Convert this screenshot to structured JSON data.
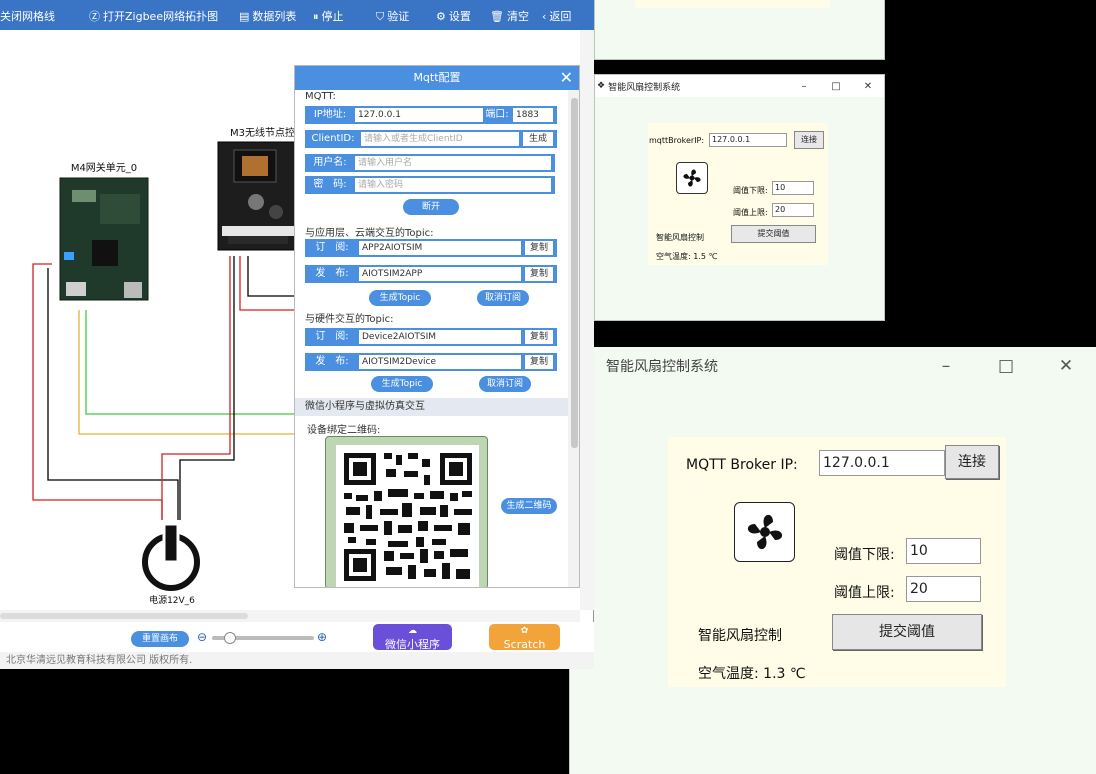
{
  "toolbar": {
    "close_grid": "关闭网格线",
    "open_zigbee": "打开Zigbee网络拓扑图",
    "data_list": "数据列表",
    "stop": "停止",
    "verify": "验证",
    "settings": "设置",
    "clear": "清空",
    "back": "返回"
  },
  "canvas": {
    "m4_label": "M4网关单元_0",
    "m3_label": "M3无线节点控",
    "power_label": "电源12V_6"
  },
  "bottombar": {
    "reset_canvas": "重置画布",
    "wechat_label": "微信小程序",
    "scratch_label": "Scratch",
    "zoom_level": 0.2
  },
  "footer": {
    "copyright": "北京华清远见教育科技有限公司 版权所有."
  },
  "mqtt_dialog": {
    "title": "Mqtt配置",
    "section_mqtt": "MQTT:",
    "ip_label": "IP地址:",
    "ip_value": "127.0.0.1",
    "port_label": "端口:",
    "port_value": "1883",
    "clientid_label": "ClientID:",
    "clientid_placeholder": "请输入或者生成ClientID",
    "generate_btn": "生成",
    "username_label": "用户名:",
    "username_placeholder": "请输入用户名",
    "password_label": "密　码:",
    "password_placeholder": "请输入密码",
    "disconnect_btn": "断开",
    "section_app": "与应用层、云端交互的Topic:",
    "subscribe_label": "订　阅:",
    "publish_label": "发　布:",
    "app_sub_value": "APP2AIOTSIM",
    "app_pub_value": "AIOTSIM2APP",
    "copy_btn": "复制",
    "gen_topic_btn": "生成Topic",
    "unsubscribe_btn": "取消订阅",
    "section_hw": "与硬件交互的Topic:",
    "hw_sub_value": "Device2AIOTSIM",
    "hw_pub_value": "AIOTSIM2Device",
    "band_label": "微信小程序与虚拟仿真交互",
    "qr_label": "设备绑定二维码:",
    "gen_qr_btn": "生成二维码"
  },
  "small_window": {
    "title": "智能风扇控制系统",
    "broker_label": "mqttBrokerIP:",
    "broker_value": "127.0.0.1",
    "connect_btn": "连接",
    "low_label": "阈值下限:",
    "low_value": "10",
    "high_label": "阈值上限:",
    "high_value": "20",
    "fan_ctrl_label": "智能风扇控制",
    "submit_btn": "提交阈值",
    "temp_label": "空气温度: 1.5 ℃"
  },
  "big_window": {
    "title": "智能风扇控制系统",
    "broker_label": "MQTT Broker IP:",
    "broker_value": "127.0.0.1",
    "connect_btn": "连接",
    "low_label": "阈值下限:",
    "low_value": "10",
    "high_label": "阈值上限:",
    "high_value": "20",
    "fan_ctrl_label": "智能风扇控制",
    "submit_btn": "提交阈值",
    "temp_label": "空气温度: 1.3 ℃"
  },
  "colors": {
    "toolbar": "#3a74c4",
    "accent": "#4a8fe0",
    "wechat_button": "#6a4fd8",
    "scratch_button": "#f2a33a",
    "wire_red": "#d42020",
    "wire_green": "#3fcc3f",
    "wire_yellow": "#e6b23a"
  }
}
